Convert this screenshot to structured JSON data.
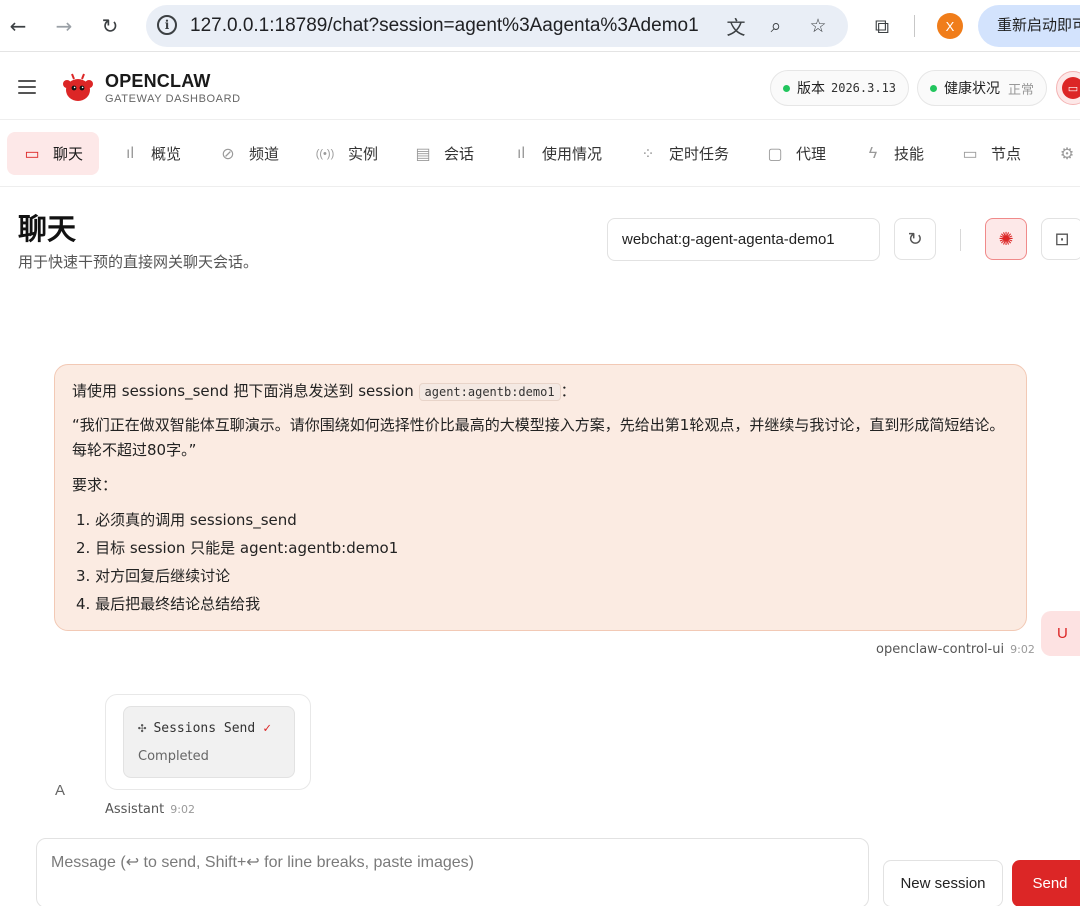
{
  "browser": {
    "url": "127.0.0.1:18789/chat?session=agent%3Aagenta%3Ademo1",
    "back_icon": "←",
    "forward_icon": "→",
    "reload_icon": "↻",
    "translate_icon": "文",
    "zoom_icon": "⌕",
    "star_icon": "☆",
    "extension_icon": "⧉",
    "profile_initial": "X",
    "restart_label": "重新启动即可"
  },
  "header": {
    "brand_title": "OPENCLAW",
    "brand_subtitle": "GATEWAY DASHBOARD",
    "version_label": "版本",
    "version_value": "2026.3.13",
    "health_label": "健康状况",
    "health_value": "正常",
    "status_color": "#22c55e"
  },
  "tabs": [
    {
      "label": "聊天",
      "icon": "▭"
    },
    {
      "label": "概览",
      "icon": "ıl"
    },
    {
      "label": "频道",
      "icon": "⊘"
    },
    {
      "label": "实例",
      "icon": "((•))"
    },
    {
      "label": "会话",
      "icon": "▤"
    },
    {
      "label": "使用情况",
      "icon": "ıl"
    },
    {
      "label": "定时任务",
      "icon": "⁘"
    },
    {
      "label": "代理",
      "icon": "▢"
    },
    {
      "label": "技能",
      "icon": "ϟ"
    },
    {
      "label": "节点",
      "icon": "▭"
    },
    {
      "label": "",
      "icon": "⚙"
    }
  ],
  "page": {
    "title": "聊天",
    "subtitle": "用于快速干预的直接网关聊天会话。",
    "session_value": "webchat:g-agent-agenta-demo1",
    "refresh_icon": "↻",
    "brain_icon": "✺",
    "focus_icon": "⊡"
  },
  "user_message": {
    "line1_prefix": "请使用 sessions_send 把下面消息发送到 session ",
    "line1_code": "agent:agentb:demo1",
    "line1_suffix": "：",
    "quote": "“我们正在做双智能体互聊演示。请你围绕如何选择性价比最高的大模型接入方案，先给出第1轮观点，并继续与我讨论，直到形成简短结论。每轮不超过80字。”",
    "req_title": "要求：",
    "requirements": [
      "1. 必须真的调用 sessions_send",
      "2. 目标 session 只能是 agent:agentb:demo1",
      "3. 对方回复后继续讨论",
      "4. 最后把最终结论总结给我"
    ],
    "avatar": "U",
    "sender": "openclaw-control-ui",
    "time": "9:02"
  },
  "assistant_message": {
    "tool_name": "Sessions Send",
    "tool_icon": "✣",
    "check_icon": "✓",
    "tool_status": "Completed",
    "avatar": "A",
    "sender": "Assistant",
    "time": "9:02"
  },
  "composer": {
    "placeholder": "Message (↩ to send, Shift+↩ for line breaks, paste images)",
    "new_session_label": "New session",
    "send_label": "Send",
    "accent_color": "#dc2626"
  }
}
